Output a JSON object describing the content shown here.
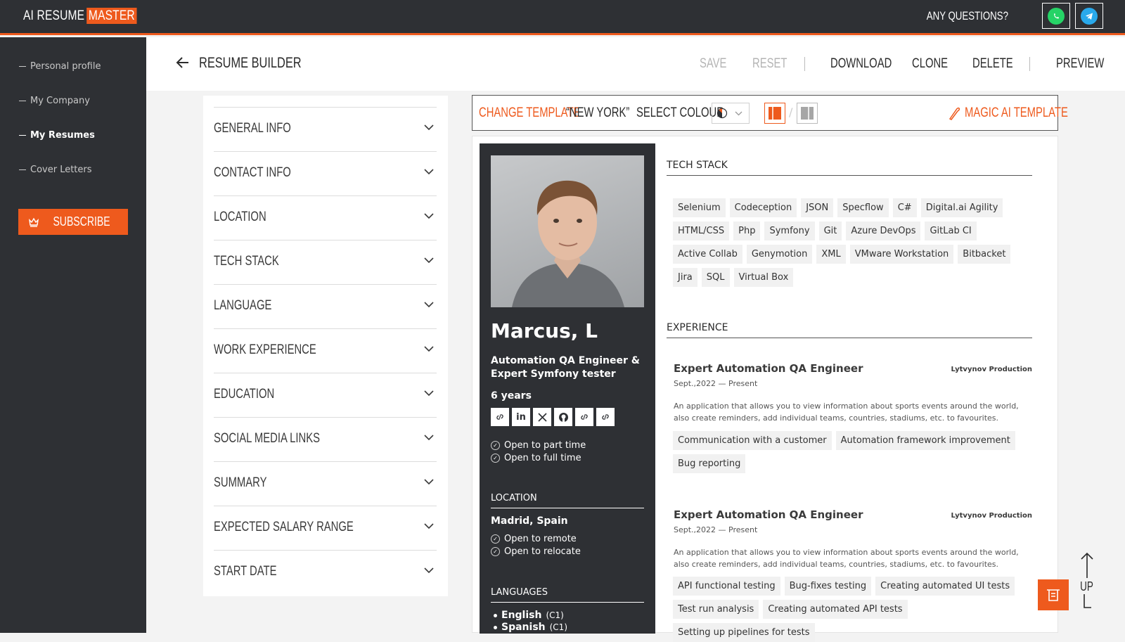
{
  "topbar": {
    "logo_prefix": "AI RESUME",
    "logo_accent": "MASTER",
    "questions": "ANY QUESTIONS?"
  },
  "sidebar": {
    "items": [
      {
        "label": "Personal profile"
      },
      {
        "label": "My Company"
      },
      {
        "label": "My Resumes"
      },
      {
        "label": "Cover Letters"
      }
    ],
    "subscribe": "SUBSCRIBE"
  },
  "header": {
    "title": "RESUME BUILDER",
    "save": "SAVE",
    "reset": "RESET",
    "download": "DOWNLOAD",
    "clone": "CLONE",
    "delete": "DELETE",
    "preview": "PREVIEW"
  },
  "sections": [
    "GENERAL INFO",
    "CONTACT INFO",
    "LOCATION",
    "TECH STACK",
    "LANGUAGE",
    "WORK EXPERIENCE",
    "EDUCATION",
    "SOCIAL MEDIA LINKS",
    "SUMMARY",
    "EXPECTED SALARY RANGE",
    "START DATE"
  ],
  "template_bar": {
    "change_label": "CHANGE TEMPLATE",
    "template_name": "“NEW YORK”",
    "select_colour": "SELECT COLOUR",
    "magic": "MAGIC AI TEMPLATE",
    "accent": "#ee5a1d"
  },
  "resume": {
    "name": "Marcus, L",
    "role": "Automation QA Engineer & Expert Symfony tester",
    "years": "6 years",
    "links": [
      "link-icon",
      "linkedin-icon",
      "x-icon",
      "github-icon",
      "link-icon",
      "link-icon"
    ],
    "availability": [
      "Open to part time",
      "Open to full time"
    ],
    "location_heading": "LOCATION",
    "location": "Madrid, Spain",
    "location_options": [
      "Open to remote",
      "Open to relocate"
    ],
    "languages_heading": "LANGUAGES",
    "languages": [
      {
        "name": "English",
        "level": "(C1)"
      },
      {
        "name": "Spanish",
        "level": "(C1)"
      }
    ],
    "tech_heading": "TECH STACK",
    "tech": [
      "Selenium",
      "Codeception",
      "JSON",
      "Specflow",
      "C#",
      "Digital.ai Agility",
      "HTML/CSS",
      "Php",
      "Symfony",
      "Git",
      "Azure DevOps",
      "GitLab CI",
      "Active Collab",
      "Genymotion",
      "XML",
      "VMware Workstation",
      "Bitbacket",
      "Jira",
      "SQL",
      "Virtual Box"
    ],
    "experience_heading": "EXPERIENCE",
    "experience": [
      {
        "title": "Expert Automation QA Engineer",
        "company": "Lytvynov Production",
        "dates": "Sept.,2022 — Present",
        "description": "An application that allows you to view information about sports events around the world, also create reminders, add individual teams, countries, stadiums, etc. to favourites.",
        "tags": [
          "Communication with a customer",
          "Automation framework improvement",
          "Bug reporting"
        ]
      },
      {
        "title": "Expert Automation QA Engineer",
        "company": "Lytvynov Production",
        "dates": "Sept.,2022 — Present",
        "description": "An application that allows you to view information about sports events around the world, also create reminders, add individual teams, countries, stadiums, etc. to favourites.",
        "tags": [
          "API functional testing",
          "Bug-fixes testing",
          "Creating automated UI tests",
          "Test run analysis",
          "Creating automated API tests",
          "Setting up pipelines for tests"
        ]
      }
    ]
  },
  "floating": {
    "up_label": "UP"
  }
}
